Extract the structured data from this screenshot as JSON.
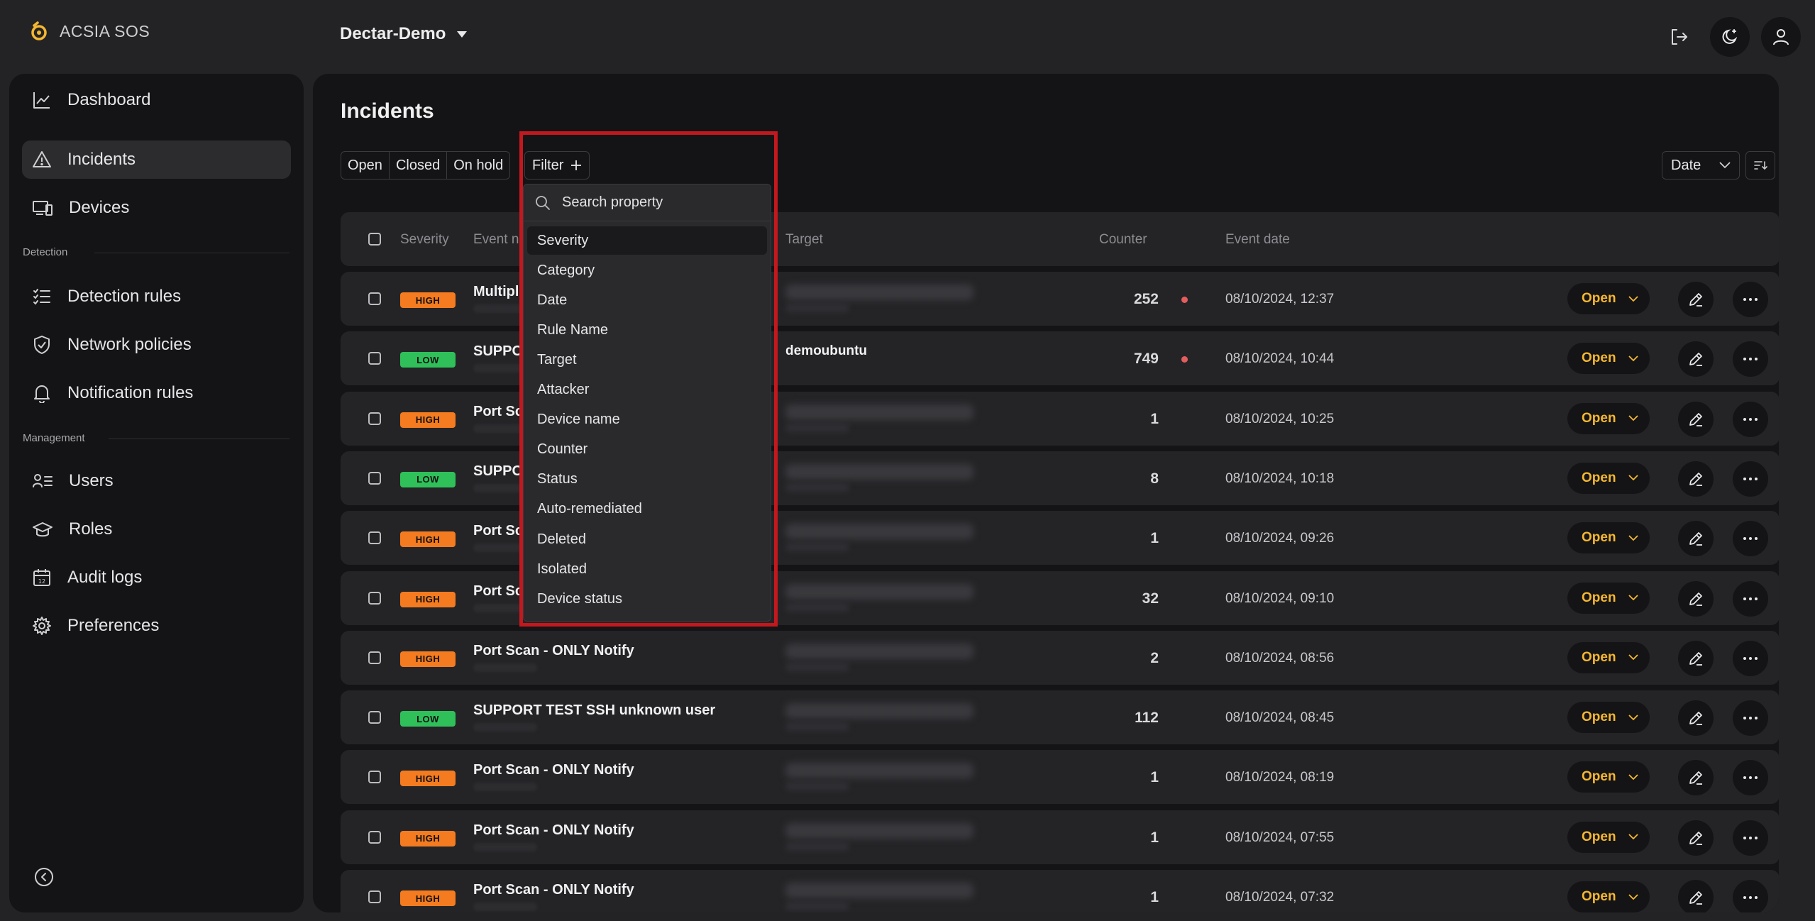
{
  "app": {
    "name": "ACSIA SOS",
    "workspace": "Dectar-Demo"
  },
  "sidebar": {
    "items": [
      {
        "label": "Dashboard",
        "icon": "chart-line-icon"
      },
      {
        "label": "Incidents",
        "icon": "warning-triangle-icon",
        "active": true
      },
      {
        "label": "Devices",
        "icon": "devices-icon"
      }
    ],
    "detection_label": "Detection",
    "detection_items": [
      {
        "label": "Detection rules",
        "icon": "checklist-icon"
      },
      {
        "label": "Network policies",
        "icon": "shield-check-icon"
      },
      {
        "label": "Notification rules",
        "icon": "bell-icon"
      }
    ],
    "management_label": "Management",
    "management_items": [
      {
        "label": "Users",
        "icon": "users-list-icon"
      },
      {
        "label": "Roles",
        "icon": "graduation-cap-icon"
      },
      {
        "label": "Audit logs",
        "icon": "calendar-icon"
      },
      {
        "label": "Preferences",
        "icon": "gear-icon"
      }
    ]
  },
  "main": {
    "title": "Incidents",
    "status_tabs": [
      "Open",
      "Closed",
      "On hold"
    ],
    "filter_label": "Filter",
    "sort_label": "Date",
    "columns": {
      "severity": "Severity",
      "event_name": "Event name",
      "target": "Target",
      "counter": "Counter",
      "event_date": "Event date"
    },
    "rows": [
      {
        "severity": "HIGH",
        "event": "Multiple failed logins",
        "target": "",
        "counter": "252",
        "alert": true,
        "date": "08/10/2024, 12:37",
        "status": "Open"
      },
      {
        "severity": "LOW",
        "event": "SUPPORT TEST SSH unknown user",
        "target": "demoubuntu",
        "counter": "749",
        "alert": true,
        "date": "08/10/2024, 10:44",
        "status": "Open"
      },
      {
        "severity": "HIGH",
        "event": "Port Scan - ONLY Notify",
        "target": "",
        "counter": "1",
        "alert": false,
        "date": "08/10/2024, 10:25",
        "status": "Open"
      },
      {
        "severity": "LOW",
        "event": "SUPPORT TEST SSH unknown user",
        "target": "",
        "counter": "8",
        "alert": false,
        "date": "08/10/2024, 10:18",
        "status": "Open"
      },
      {
        "severity": "HIGH",
        "event": "Port Scan - ONLY Notify",
        "target": "",
        "counter": "1",
        "alert": false,
        "date": "08/10/2024, 09:26",
        "status": "Open"
      },
      {
        "severity": "HIGH",
        "event": "Port Scan - ONLY Notify",
        "target": "",
        "counter": "32",
        "alert": false,
        "date": "08/10/2024, 09:10",
        "status": "Open"
      },
      {
        "severity": "HIGH",
        "event": "Port Scan - ONLY Notify",
        "target": "",
        "counter": "2",
        "alert": false,
        "date": "08/10/2024, 08:56",
        "status": "Open"
      },
      {
        "severity": "LOW",
        "event": "SUPPORT TEST SSH unknown user",
        "target": "",
        "counter": "112",
        "alert": false,
        "date": "08/10/2024, 08:45",
        "status": "Open"
      },
      {
        "severity": "HIGH",
        "event": "Port Scan - ONLY Notify",
        "target": "",
        "counter": "1",
        "alert": false,
        "date": "08/10/2024, 08:19",
        "status": "Open"
      },
      {
        "severity": "HIGH",
        "event": "Port Scan - ONLY Notify",
        "target": "",
        "counter": "1",
        "alert": false,
        "date": "08/10/2024, 07:55",
        "status": "Open"
      },
      {
        "severity": "HIGH",
        "event": "Port Scan - ONLY Notify",
        "target": "",
        "counter": "1",
        "alert": false,
        "date": "08/10/2024, 07:32",
        "status": "Open"
      }
    ]
  },
  "filter_dropdown": {
    "search_placeholder": "Search property",
    "items": [
      "Severity",
      "Category",
      "Date",
      "Rule Name",
      "Target",
      "Attacker",
      "Device name",
      "Counter",
      "Status",
      "Auto-remediated",
      "Deleted",
      "Isolated",
      "Device status"
    ]
  },
  "colors": {
    "accent": "#f5b731",
    "high": "#f47b20",
    "low": "#2fc05a",
    "highlight": "#c3181e"
  }
}
